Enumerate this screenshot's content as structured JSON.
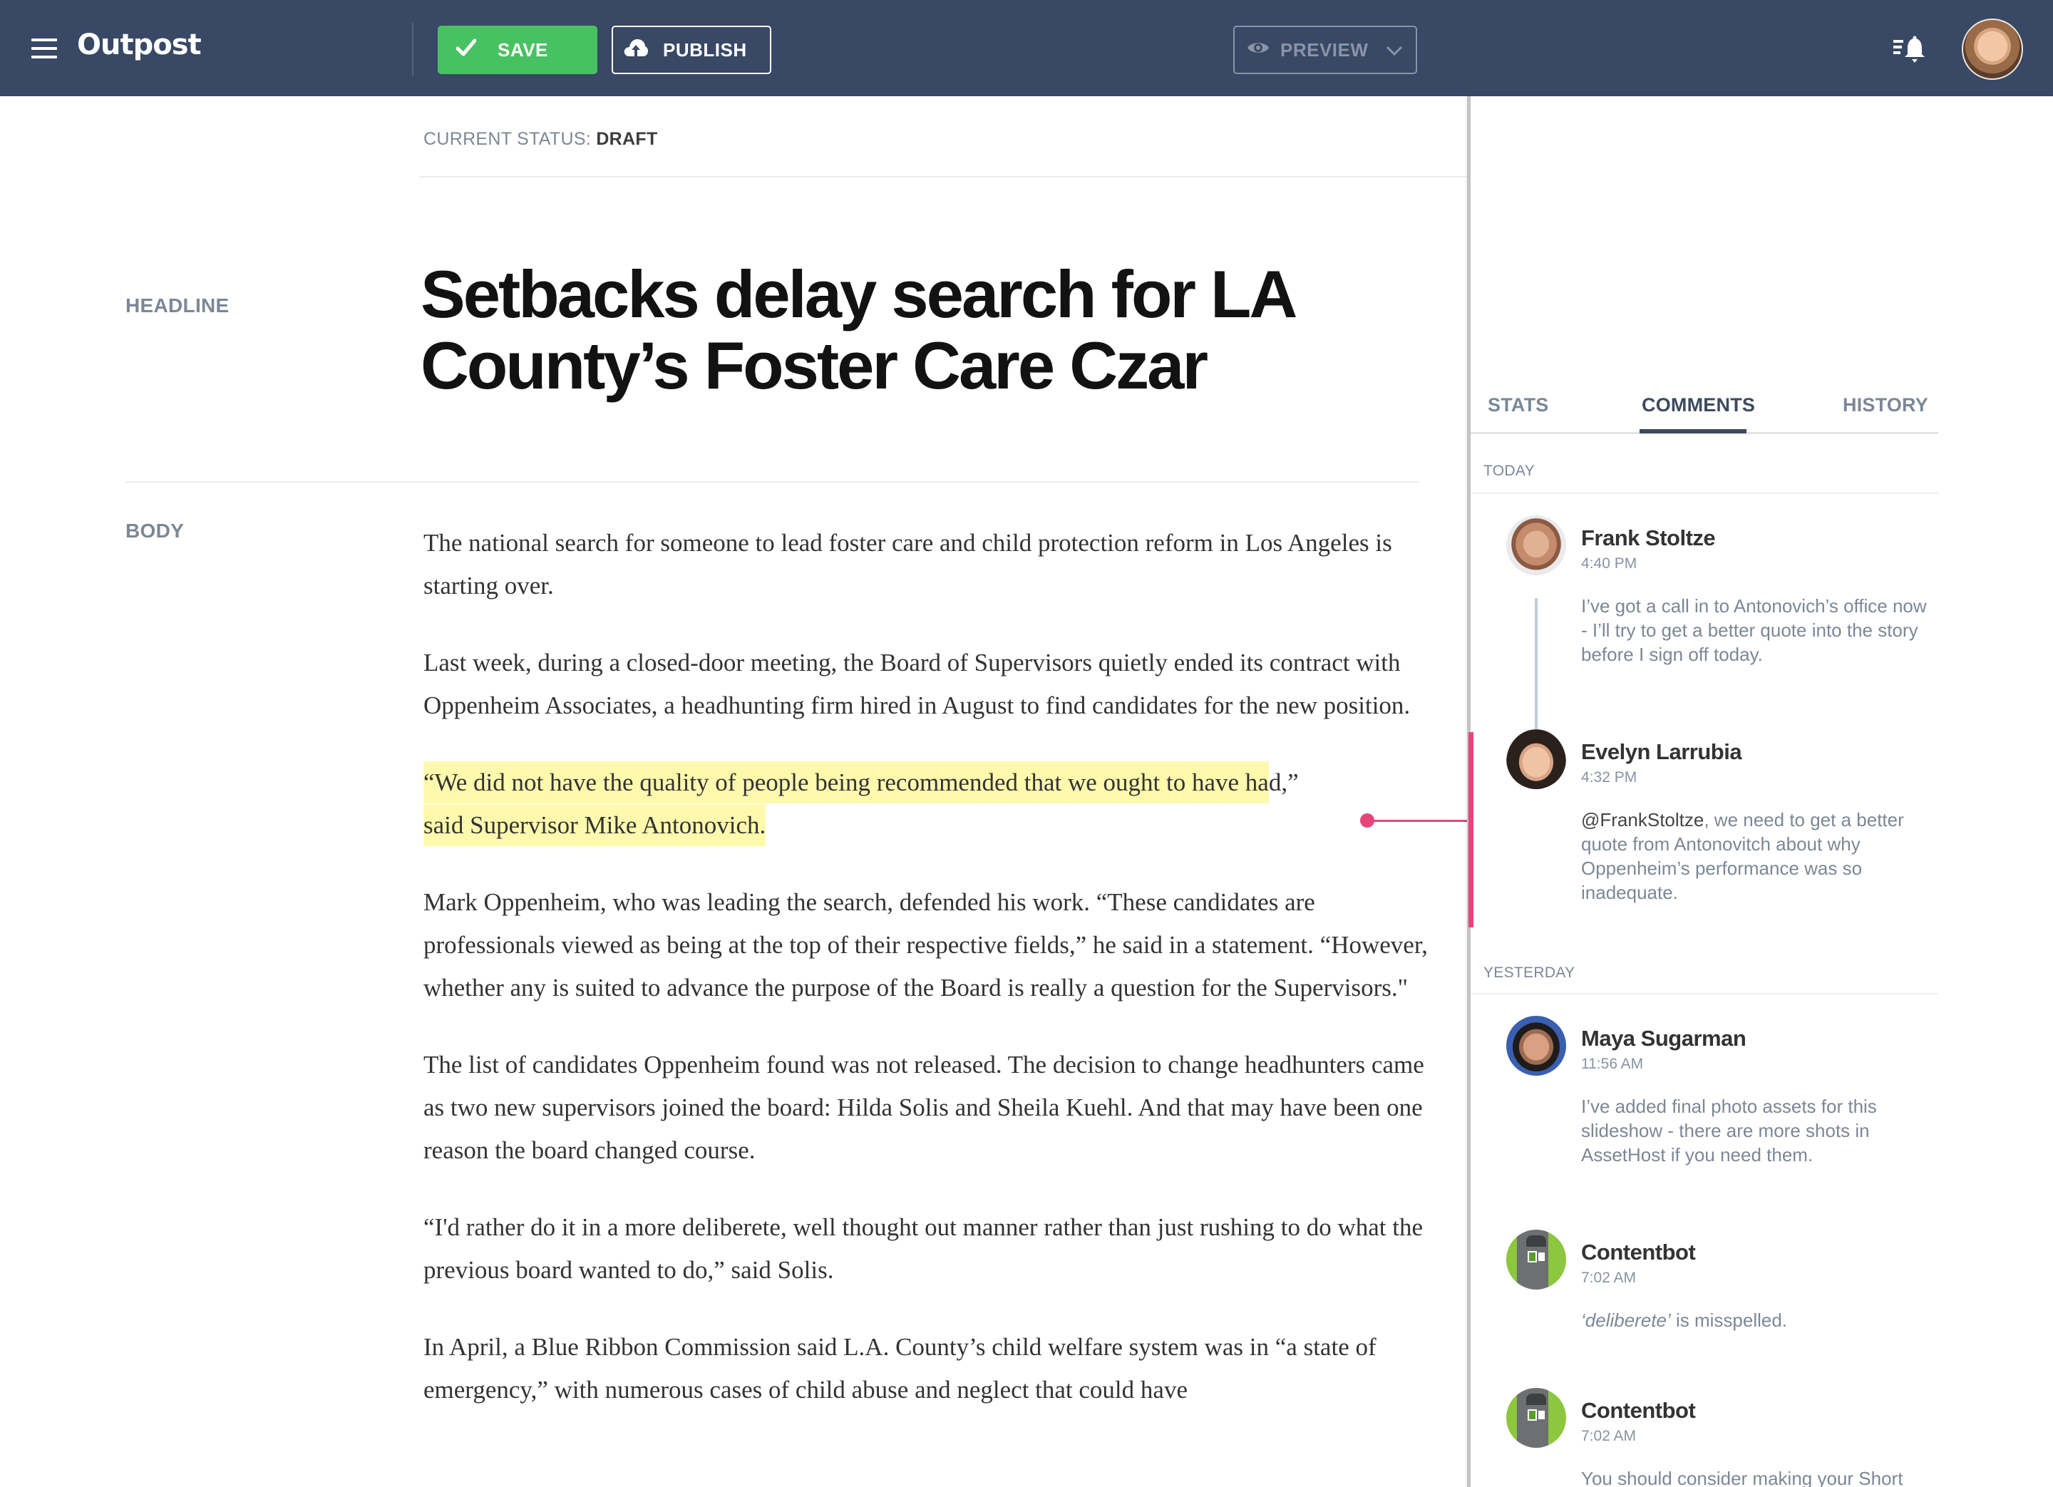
{
  "header": {
    "app_name": "Outpost",
    "save_label": "SAVE",
    "publish_label": "PUBLISH",
    "preview_label": "PREVIEW",
    "icons": {
      "menu": "hamburger-menu-icon",
      "save": "checkmark-icon",
      "publish": "cloud-upload-icon",
      "preview": "eye-icon",
      "preview_dropdown": "chevron-down-icon",
      "notifications": "notification-bell-icon",
      "user": "user-avatar"
    },
    "colors": {
      "bar": "#384865",
      "save": "#48c162",
      "accent": "#e6457a",
      "highlight": "#fff9ae"
    }
  },
  "editor": {
    "status_label": "CURRENT STATUS:",
    "status_value": "DRAFT",
    "headline_label": "HEADLINE",
    "body_label": "BODY",
    "headline": "Setbacks delay search for LA County’s Foster Care Czar",
    "paragraphs": [
      "The national search for someone to lead foster care and child protection reform in Los Angeles is starting over.",
      "Last week, during a closed-door meeting, the Board of Supervisors quietly ended its contract with Oppenheim Associates, a headhunting firm hired in August to find candidates for the new position.",
      "“We did not have the quality of people being recommended that we ought to have had,” said Supervisor Mike Antonovich.",
      "Mark Oppenheim, who was leading the search, defended his work. “These candidates are professionals viewed as being at the top of their respective fields,” he said in a statement. “However, whether any is suited to advance the purpose of the Board is really a question for the Supervisors.\"",
      "The list of candidates Oppenheim found was not released. The decision to change headhunters came as two new supervisors joined the board: Hilda Solis and Sheila Kuehl. And that may have been one reason the board changed course.",
      "“I'd rather do it in a more deliberete, well thought out manner rather than just rushing to do what the previous board wanted to do,” said Solis.",
      "In April, a Blue Ribbon Commission said L.A. County’s child welfare system was in “a state of emergency,” with numerous cases of child abuse and neglect that could have"
    ],
    "highlighted": {
      "line1": "“We did not have the quality of people being recommended that we ought to have ha",
      "line1_rest": "d,”",
      "line2": "said Supervisor Mike Antonovich."
    }
  },
  "sidebar": {
    "tabs": [
      {
        "label": "STATS",
        "active": false
      },
      {
        "label": "COMMENTS",
        "active": true
      },
      {
        "label": "HISTORY",
        "active": false
      }
    ],
    "groups": [
      {
        "label": "TODAY",
        "comments": [
          {
            "author": "Frank Stoltze",
            "time": "4:40 PM",
            "text": "I’ve got a call in to Antonovich’s office now - I’ll try to get a better quote into the story before I sign off today."
          },
          {
            "author": "Evelyn Larrubia",
            "time": "4:32 PM",
            "mention": "@FrankStoltze",
            "text": ", we need to get a better quote from Antonovitch about why Oppenheim’s performance was so inadequate."
          }
        ]
      },
      {
        "label": "YESTERDAY",
        "comments": [
          {
            "author": "Maya Sugarman",
            "time": "11:56 AM",
            "text": "I’ve added final photo assets for this slideshow - there are more shots in AssetHost if you need them."
          },
          {
            "author": "Contentbot",
            "time": "7:02 AM",
            "term": "‘deliberete’",
            "text": " is misspelled."
          },
          {
            "author": "Contentbot",
            "time": "7:02 AM",
            "text": "You should consider making your Short"
          }
        ]
      }
    ]
  }
}
